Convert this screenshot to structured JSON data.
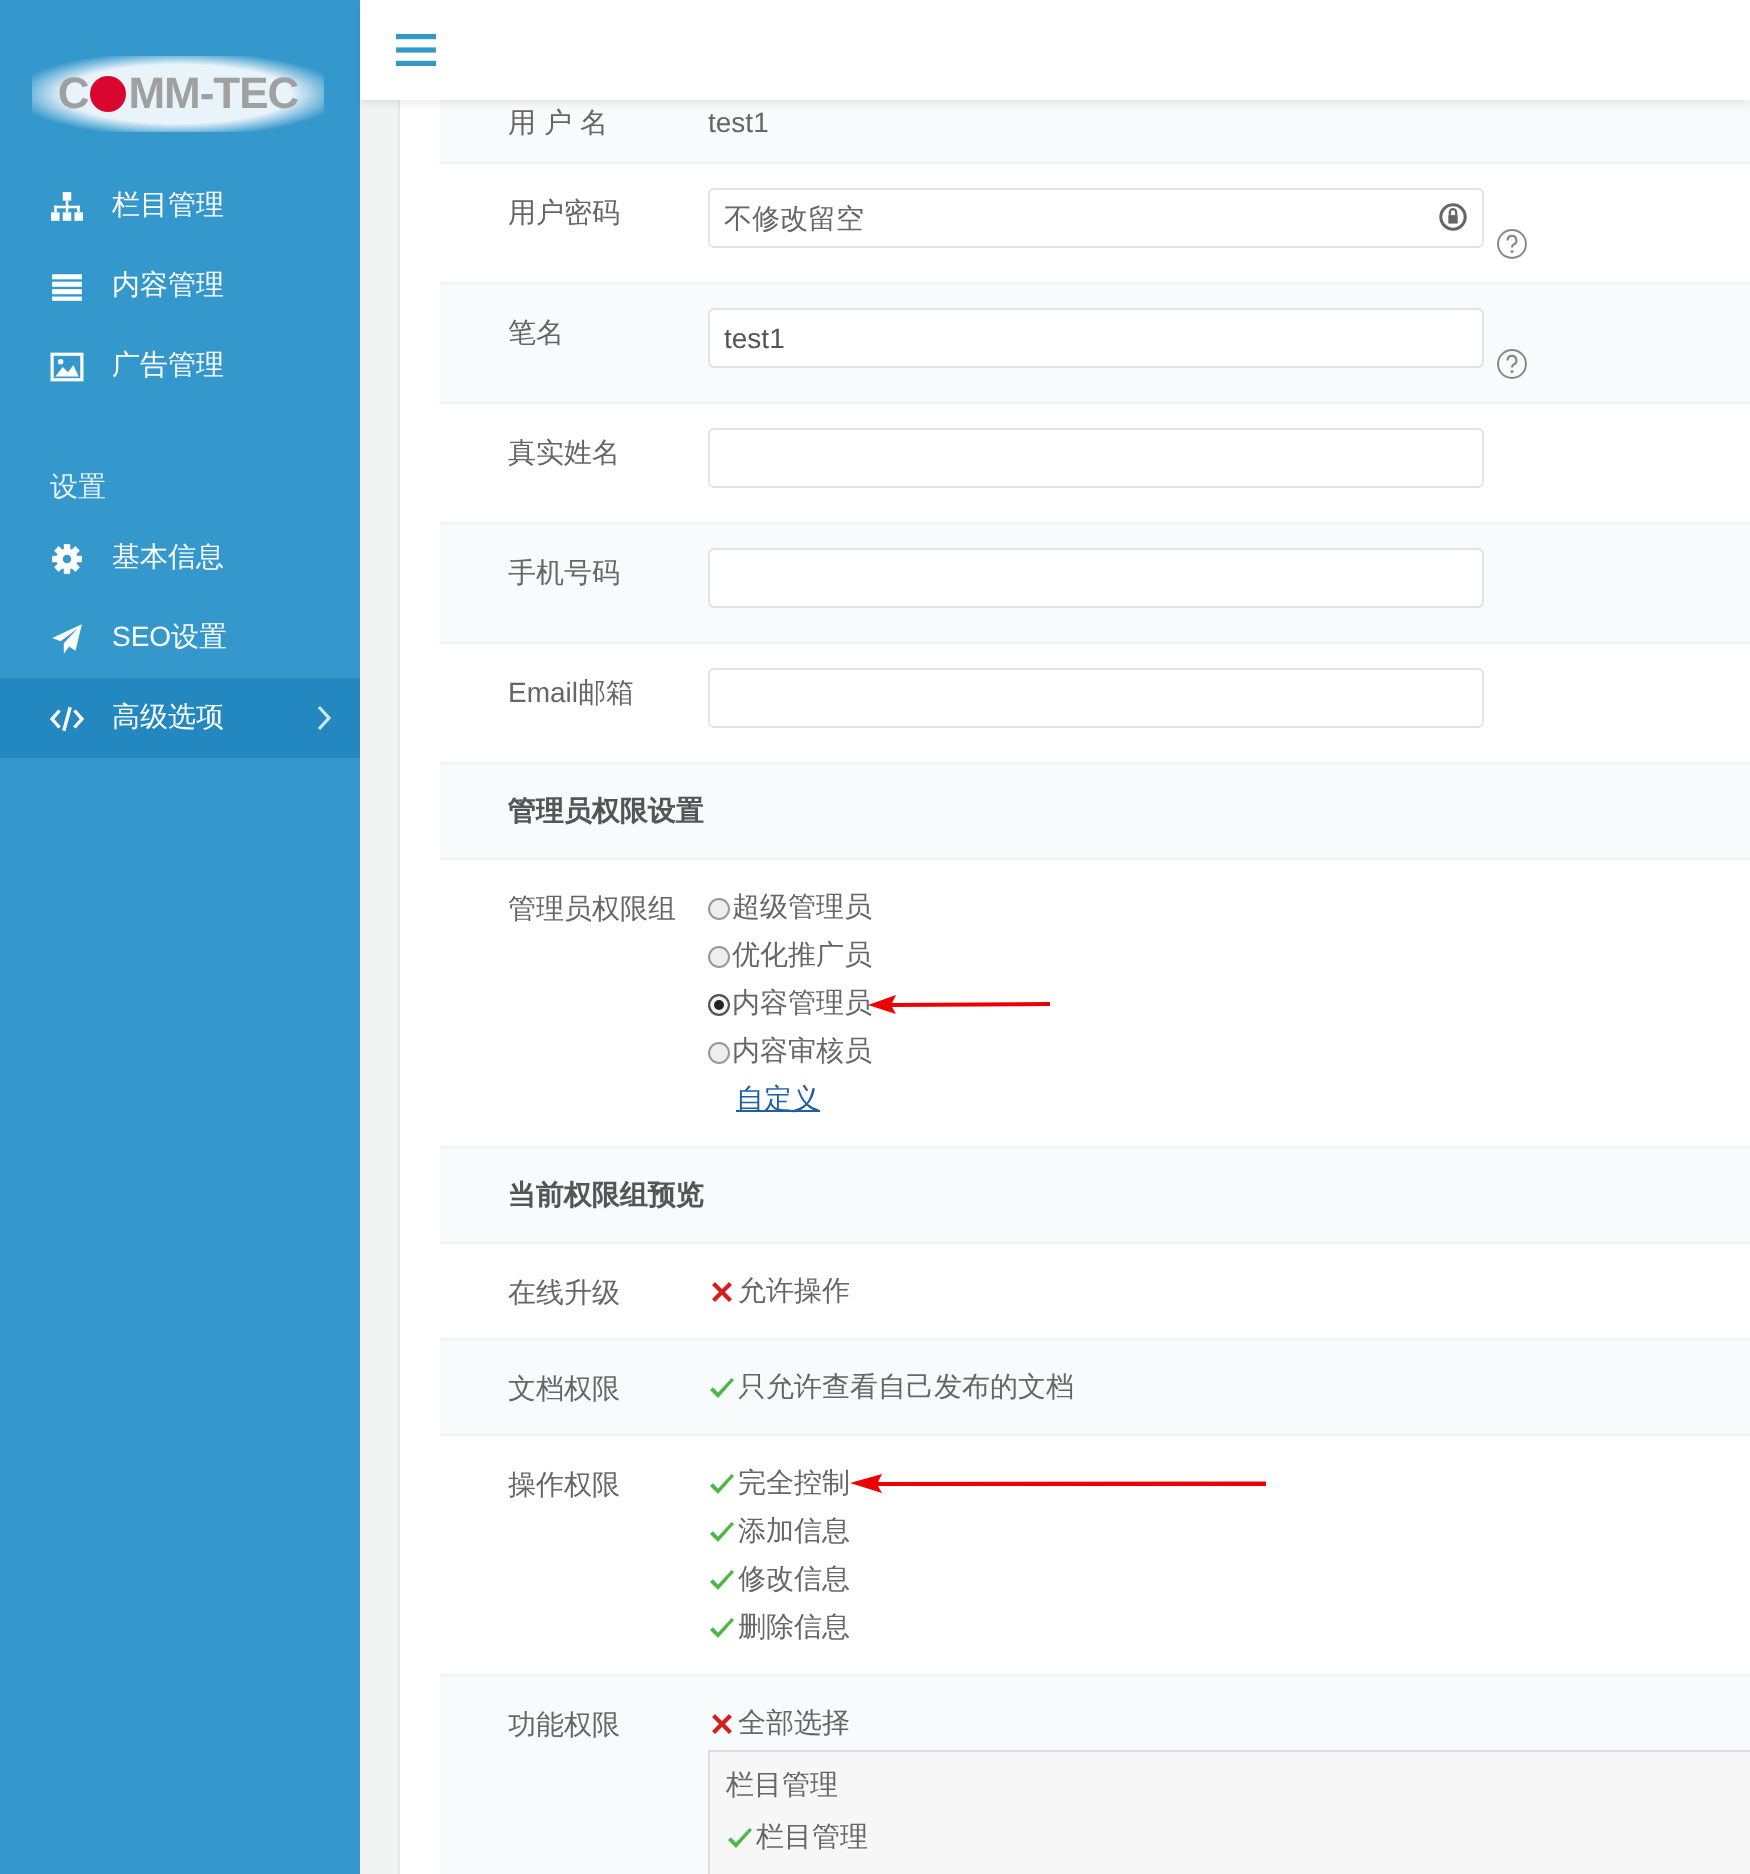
{
  "sidebar": {
    "logo": {
      "before": "C",
      "after": "MM-TEC"
    },
    "groups": [
      {
        "items": [
          {
            "label": "栏目管理",
            "selected": false,
            "has_submenu": false
          },
          {
            "label": "内容管理",
            "selected": false,
            "has_submenu": false
          },
          {
            "label": "广告管理",
            "selected": false,
            "has_submenu": false
          }
        ]
      },
      {
        "heading": "设置",
        "items": [
          {
            "label": "基本信息",
            "selected": false,
            "has_submenu": false
          },
          {
            "label": "SEO设置",
            "selected": false,
            "has_submenu": false
          },
          {
            "label": "高级选项",
            "selected": true,
            "has_submenu": true
          }
        ]
      }
    ]
  },
  "form": {
    "rows": [
      {
        "kind": "static",
        "label": "用 户 名",
        "value": "test1"
      },
      {
        "kind": "input",
        "label": "用户密码",
        "placeholder": "不修改留空",
        "lock": true,
        "help": true
      },
      {
        "kind": "input",
        "label": "笔名",
        "value": "test1",
        "lock": false,
        "help": true
      },
      {
        "kind": "input",
        "label": "真实姓名",
        "lock": false,
        "help": false
      },
      {
        "kind": "input",
        "label": "手机号码",
        "lock": false,
        "help": false
      },
      {
        "kind": "input",
        "label": "Email邮箱",
        "lock": false,
        "help": false
      },
      {
        "kind": "heading",
        "label": "管理员权限设置"
      },
      {
        "kind": "radio",
        "label": "管理员权限组",
        "options": [
          {
            "label": "超级管理员",
            "selected": false,
            "arrow": false
          },
          {
            "label": "优化推广员",
            "selected": false,
            "arrow": false
          },
          {
            "label": "内容管理员",
            "selected": true,
            "arrow": true
          },
          {
            "label": "内容审核员",
            "selected": false,
            "arrow": false
          }
        ],
        "link": "自定义"
      },
      {
        "kind": "heading",
        "label": "当前权限组预览"
      },
      {
        "kind": "perm",
        "label": "在线升级",
        "items": [
          {
            "label": "允许操作",
            "allowed": false,
            "arrow": false
          }
        ]
      },
      {
        "kind": "perm",
        "label": "文档权限",
        "items": [
          {
            "label": "只允许查看自己发布的文档",
            "allowed": true,
            "arrow": false
          }
        ]
      },
      {
        "kind": "perm",
        "label": "操作权限",
        "items": [
          {
            "label": "完全控制",
            "allowed": true,
            "arrow": true
          },
          {
            "label": "添加信息",
            "allowed": true,
            "arrow": false
          },
          {
            "label": "修改信息",
            "allowed": true,
            "arrow": false
          },
          {
            "label": "删除信息",
            "allowed": true,
            "arrow": false
          }
        ]
      },
      {
        "kind": "perm",
        "label": "功能权限",
        "items": [
          {
            "label": "全部选择",
            "allowed": false,
            "arrow": false
          }
        ],
        "box": {
          "heading": "栏目管理",
          "items": [
            {
              "label": "栏目管理",
              "allowed": true
            }
          ]
        }
      }
    ]
  }
}
